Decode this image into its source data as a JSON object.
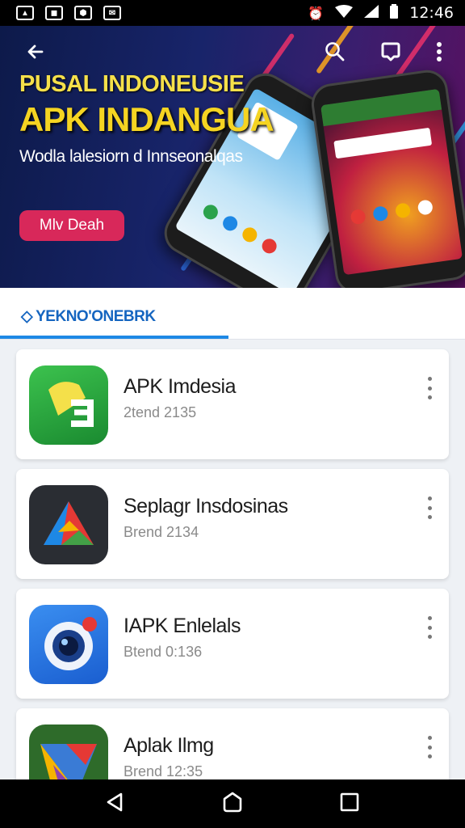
{
  "status_bar": {
    "notifications": [
      "image-icon",
      "gallery-icon",
      "shopping-bag-icon",
      "mail-icon"
    ],
    "icons": [
      "alarm-icon",
      "wifi-icon",
      "signal-icon",
      "battery-icon"
    ],
    "time": "12:46"
  },
  "hero": {
    "title_line1": "PUSAL INDONEUSIE",
    "title_line2": "APK INDANGUA",
    "subtitle": "Wodla lalesiorn d Innseonalqas",
    "cta_label": "Mlv Deah",
    "colors": {
      "title": "#f5d422",
      "cta": "#d8285a"
    }
  },
  "toolbar": {
    "back_icon": "arrow-left-icon",
    "search_icon": "search-icon",
    "chat_icon": "chat-bubble-icon",
    "menu_icon": "more-vert-icon"
  },
  "tabs": [
    {
      "label": "YEKNO'ONEBRK",
      "active": true
    }
  ],
  "apps": [
    {
      "name": "APK Imdesia",
      "meta": "2tend 2135",
      "icon": "apk-green-icon"
    },
    {
      "name": "Seplagr Insdosinas",
      "meta": "Brend 2134",
      "icon": "triangle-logo-icon"
    },
    {
      "name": "IAPK Enlelals",
      "meta": "Btend 0:136",
      "icon": "camera-lens-icon"
    },
    {
      "name": "Aplak Ilmg",
      "meta": "Brend 12:35",
      "icon": "geometric-logo-icon"
    }
  ],
  "nav": {
    "back": "back-triangle-icon",
    "home": "home-circle-icon",
    "recents": "recents-square-icon"
  },
  "accent": "#1e88e5"
}
